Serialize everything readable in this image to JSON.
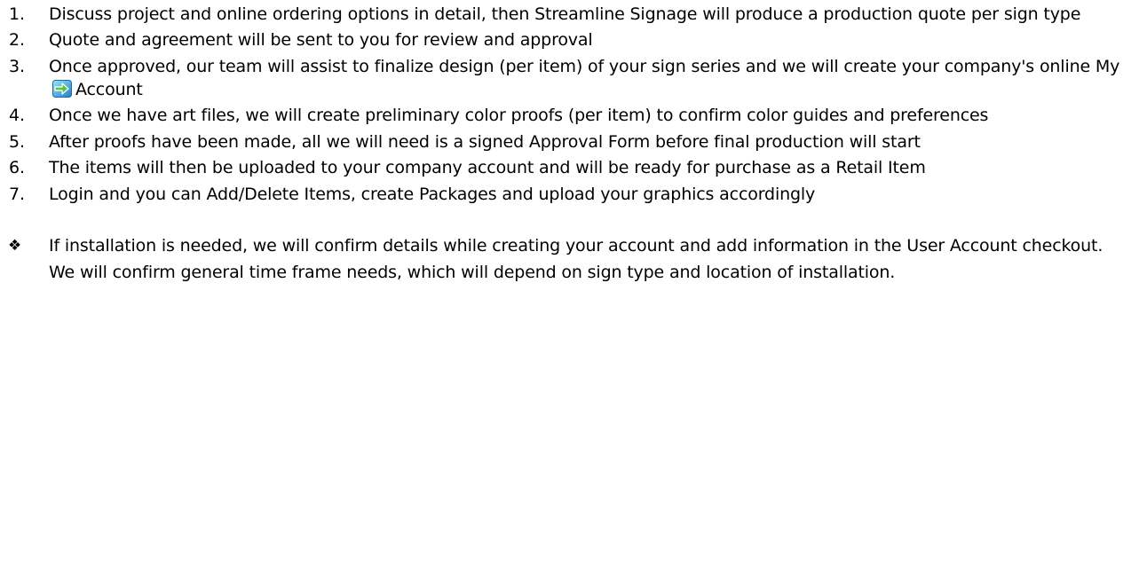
{
  "steps": [
    {
      "num": "1.",
      "text": "Discuss project and online ordering options in detail, then Streamline Signage will produce a production quote per sign type"
    },
    {
      "num": "2.",
      "text": "Quote and agreement will be sent to you for review and approval"
    },
    {
      "num": "3.",
      "text_before_icon": "Once approved, our team will assist to finalize design (per item) of your sign series and we will create your company's online My",
      "text_after_icon": "Account"
    },
    {
      "num": "4.",
      "text": "Once we have art files, we will create preliminary color proofs (per item) to confirm color guides and preferences"
    },
    {
      "num": "5.",
      "text": "After proofs have been made, all we will need is a signed Approval Form before final production will start"
    },
    {
      "num": "6.",
      "text": "The items will then be uploaded to your company account and will be ready for purchase as a Retail Item"
    },
    {
      "num": "7.",
      "text": "Login and you can Add/Delete Items, create Packages and upload your graphics accordingly"
    }
  ],
  "note": {
    "bullet": "❖",
    "text": "If installation is needed, we will confirm details while creating your account and add information in the User Account checkout. We will confirm general time frame needs, which will depend on sign type and location of installation."
  },
  "icons": {
    "account_icon": "arrow-right-icon"
  },
  "colors": {
    "text": "#000000",
    "icon_light": "#7ad3f2",
    "icon_dark": "#1d7fc4",
    "arrow_green": "#5cc43c"
  }
}
